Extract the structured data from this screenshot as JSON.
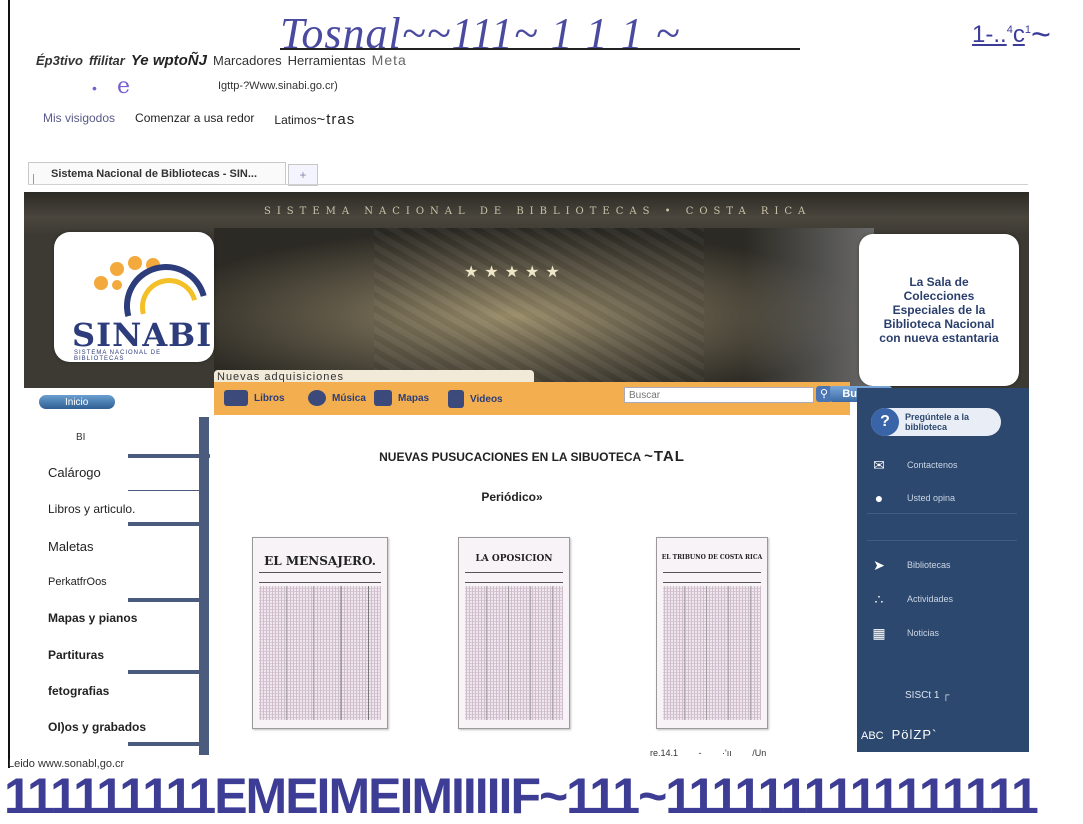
{
  "window": {
    "title": "Tosnal~~111~ 1 1 1 ~",
    "controls": "1-..",
    "controls_sup": "4",
    "controls_tail": "c",
    "controls_tail_sup": "1",
    "controls_end": "~"
  },
  "menu": {
    "item1": "Ép3tivo",
    "item2": "ffilitar",
    "item3": "Ye wptoÑJ",
    "item4": "Marcadores",
    "item5": "Herramientas",
    "item6": "Meta"
  },
  "address": {
    "bullet": "•",
    "e": "e",
    "url": "Igttp-?Www.sinabi.go.cr)"
  },
  "bookmarks": {
    "b1": "Mis visigodos",
    "b2": "Comenzar a usa redor",
    "b3": "Latimos",
    "b3_suffix": "~tras"
  },
  "tab": {
    "title": "Sistema Nacional de Bibliotecas - SIN...",
    "new_tab": "+"
  },
  "banner": {
    "heading": "SISTEMA NACIONAL DE BIBLIOTECAS • COSTA RICA",
    "logo_name": "SINABI",
    "logo_tagline": "SISTEMA NACIONAL DE BIBLIOTECAS",
    "promo": "La Sala de Colecciones Especiales de la Biblioteca Nacional con nueva estantaria"
  },
  "navbar": {
    "caption": "Nuevas adquisiciones",
    "home": "Inicio",
    "links": [
      "Libros",
      "Música",
      "Mapas",
      "Videos"
    ],
    "search_placeholder": "Buscar",
    "search_button": "Buscar"
  },
  "sidebar": {
    "heading": "BI",
    "items": [
      "Calárogo",
      "Libros y articulo.",
      "Maletas",
      "PerkatfrOos",
      "Mapas y pianos",
      "Partituras",
      "fetografias",
      "OI)os y grabados"
    ]
  },
  "main": {
    "title": "NUEVAS PUSUCACIONES EN LA SIBUOTECA",
    "title_suffix": "~TAL",
    "subtitle": "Periódico»",
    "papers": [
      "EL MENSAJERO.",
      "LA OPOSICION",
      "EL TRIBUNO DE COSTA RICA"
    ],
    "caption": "re.14.1 - ·'ıı /Un"
  },
  "right_panel": {
    "ask": "Pregúntele a la biblioteca",
    "items": [
      "Contactenos",
      "Usted opina",
      "Bibliotecas",
      "Actividades",
      "Noticias"
    ],
    "footer": "SISCt 1  ┌",
    "abc": "ABC",
    "abc_logo": "PölZP`"
  },
  "status": {
    "text": "Leido www.sonabl,go.cr"
  },
  "bottom": {
    "band": "111111111EMEIMEIMIIIIIF~111~1111111111111111"
  }
}
